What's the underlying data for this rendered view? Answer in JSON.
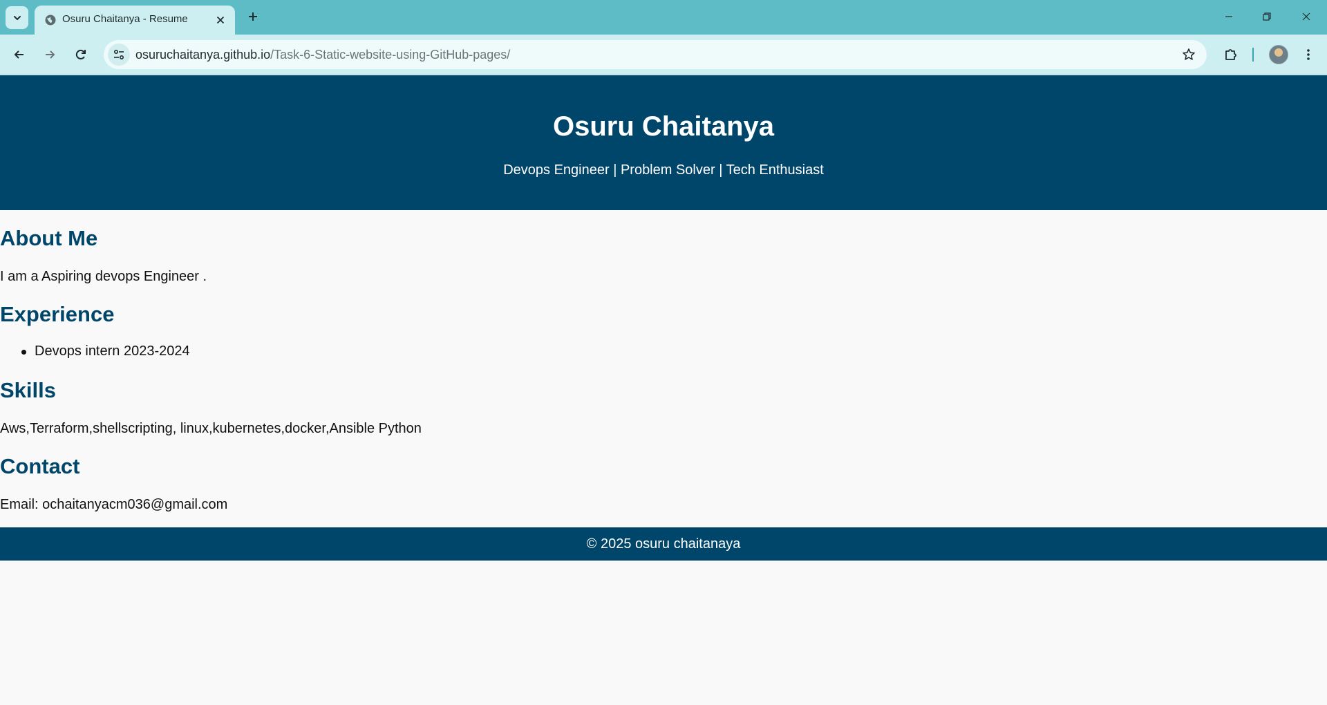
{
  "browser": {
    "tab": {
      "title": "Osuru Chaitanya - Resume",
      "favicon": "globe-icon"
    },
    "url": {
      "host": "osuruchaitanya.github.io",
      "path": "/Task-6-Static-website-using-GitHub-pages/"
    },
    "colors": {
      "tabbar": "#5dbcc5",
      "toolbar": "#cdeff2"
    }
  },
  "page": {
    "header": {
      "name": "Osuru Chaitanya",
      "tagline": "Devops Engineer | Problem Solver | Tech Enthusiast"
    },
    "about": {
      "title": "About Me",
      "text": "I am a Aspiring devops Engineer ."
    },
    "experience": {
      "title": "Experience",
      "items": [
        "Devops intern 2023-2024"
      ]
    },
    "skills": {
      "title": "Skills",
      "text": "Aws,Terraform,shellscripting, linux,kubernetes,docker,Ansible Python"
    },
    "contact": {
      "title": "Contact",
      "text": "Email: ochaitanyacm036@gmail.com"
    },
    "footer": {
      "text": "© 2025 osuru chaitanaya"
    },
    "colors": {
      "primary": "#00466a",
      "background": "#f9f9f9"
    }
  }
}
